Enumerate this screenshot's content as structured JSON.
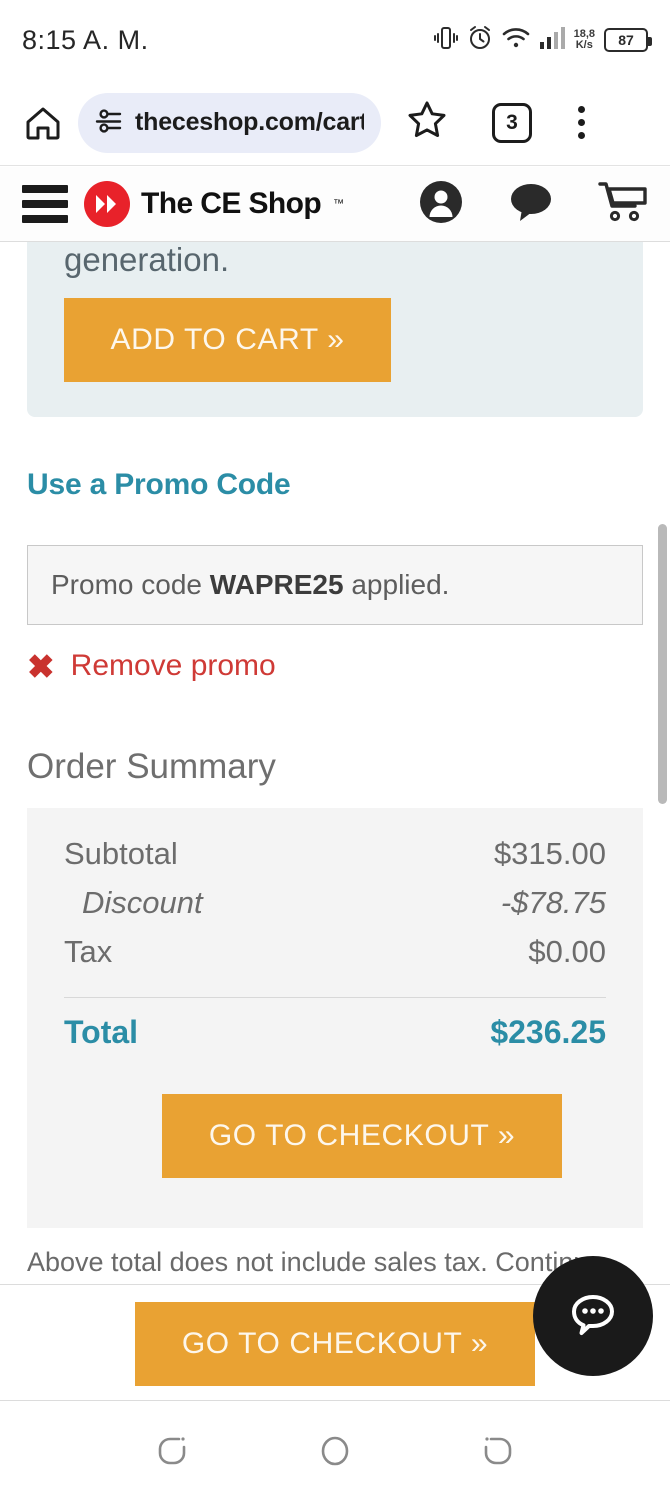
{
  "status_bar": {
    "time": "8:15 A. M.",
    "icons": [
      "vibrate-icon",
      "alarm-icon",
      "wifi-icon",
      "signal-icon"
    ],
    "network_speed": "18,8\nK/s",
    "network_speed_value": "18,8",
    "network_speed_unit": "K/s",
    "battery_level": "87"
  },
  "browser": {
    "home_icon": "home-icon",
    "site_settings_icon": "tune-icon",
    "url": "theceshop.com/cart-",
    "bookmark_icon": "star-icon",
    "tab_count": "3",
    "menu_icon": "overflow-menu-icon"
  },
  "site_header": {
    "menu_icon": "hamburger-icon",
    "brand_name": "The CE Shop",
    "brand_trademark": "™",
    "brand_mark_color": "#e8222a",
    "account_icon": "account-icon",
    "chat_icon": "chat-bubble-icon",
    "cart_icon": "shopping-cart-icon"
  },
  "product_promo": {
    "text": "generation.",
    "add_to_cart_label": "ADD TO CART »",
    "card_color": "#e8eff1",
    "button_color": "#e9a233"
  },
  "promo_code": {
    "heading": "Use a Promo Code",
    "heading_color": "#2b8da6",
    "applied_prefix": "Promo code ",
    "applied_code": "WAPRE25",
    "applied_suffix": " applied.",
    "remove_icon": "x-mark-icon",
    "remove_label": "Remove promo",
    "remove_color": "#cf3a36"
  },
  "order_summary": {
    "title": "Order Summary",
    "rows": [
      {
        "label": "Subtotal",
        "value": "$315.00",
        "style": "normal"
      },
      {
        "label": "Discount",
        "value": "-$78.75",
        "style": "italic"
      },
      {
        "label": "Tax",
        "value": "$0.00",
        "style": "normal"
      }
    ],
    "total_label": "Total",
    "total_value": "$236.25",
    "total_color": "#2b8da6",
    "checkout_label": "GO TO CHECKOUT »",
    "tax_note": "Above total does not include sales tax. Continu"
  },
  "sticky_bar": {
    "checkout_label": "GO TO CHECKOUT »"
  },
  "chat_widget": {
    "icon": "chat-bubble-dots-icon",
    "background_color": "#1a1a1a"
  },
  "android_nav": {
    "back_icon": "back-icon",
    "home_icon": "home-circle-icon",
    "recents_icon": "recents-icon"
  }
}
